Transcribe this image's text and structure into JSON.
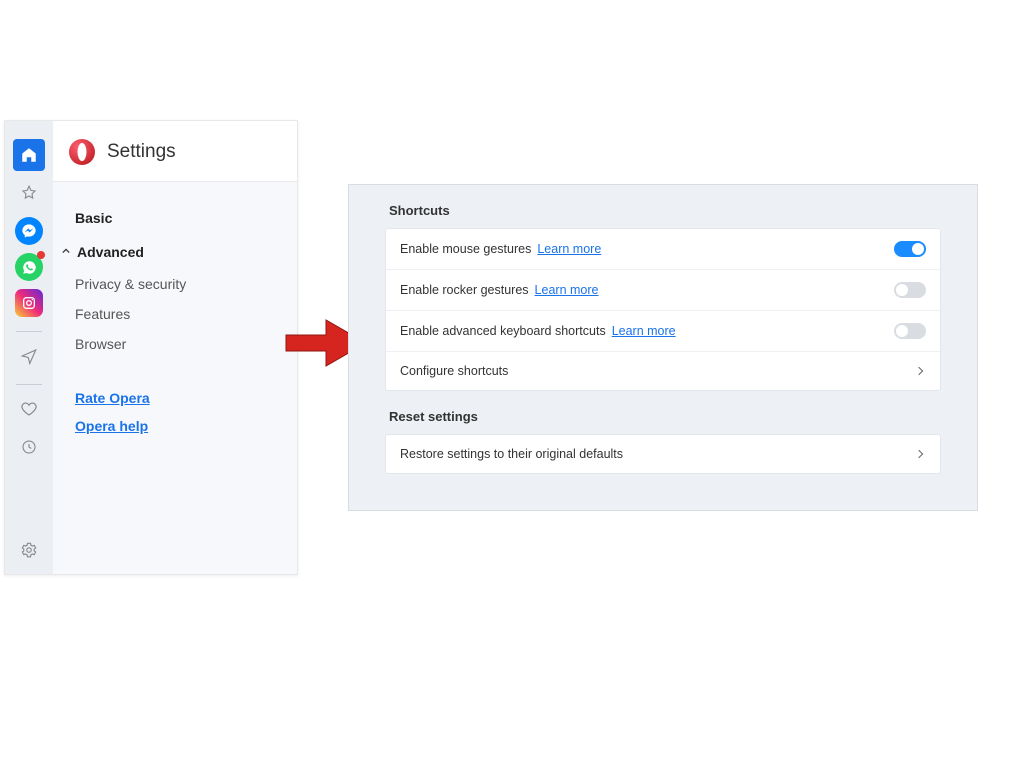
{
  "header": {
    "title": "Settings"
  },
  "sidebar_rail": {
    "icons": [
      {
        "name": "speed-dial-icon"
      },
      {
        "name": "bookmarks-icon"
      },
      {
        "name": "messenger-icon"
      },
      {
        "name": "whatsapp-icon"
      },
      {
        "name": "instagram-icon"
      },
      {
        "name": "send-icon"
      },
      {
        "name": "heart-icon"
      },
      {
        "name": "history-icon"
      },
      {
        "name": "settings-gear-icon"
      }
    ]
  },
  "nav": {
    "basic": "Basic",
    "advanced": "Advanced",
    "items": [
      {
        "label": "Privacy & security"
      },
      {
        "label": "Features"
      },
      {
        "label": "Browser"
      }
    ],
    "links": {
      "rate": "Rate Opera",
      "help": "Opera help"
    }
  },
  "learn_more": "Learn more",
  "shortcuts": {
    "title": "Shortcuts",
    "rows": [
      {
        "label": "Enable mouse gestures",
        "has_link": true,
        "toggle": true
      },
      {
        "label": "Enable rocker gestures",
        "has_link": true,
        "toggle": false
      },
      {
        "label": "Enable advanced keyboard shortcuts",
        "has_link": true,
        "toggle": false
      }
    ],
    "configure": "Configure shortcuts"
  },
  "reset": {
    "title": "Reset settings",
    "row": "Restore settings to their original defaults"
  },
  "colors": {
    "accent": "#1a8cff",
    "link": "#1a73e8",
    "arrow": "#d6241f"
  }
}
